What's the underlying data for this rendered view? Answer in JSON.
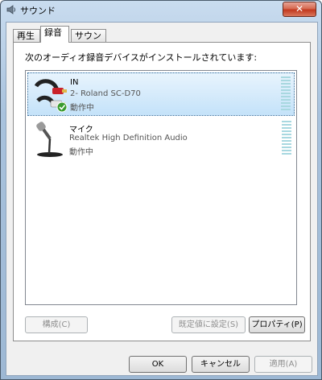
{
  "window": {
    "title": "サウンド",
    "close_label": "✕"
  },
  "tabs": [
    {
      "label": "再生"
    },
    {
      "label": "録音",
      "active": true
    },
    {
      "label": "サウンド"
    }
  ],
  "panel": {
    "instruction": "次のオーディオ録音デバイスがインストールされています:"
  },
  "devices": [
    {
      "name": "IN",
      "description": "2- Roland SC-D70",
      "status": "動作中",
      "icon": "rca-cable-icon",
      "selected": true,
      "default": true
    },
    {
      "name": "マイク",
      "description": "Realtek High Definition Audio",
      "status": "動作中",
      "icon": "microphone-icon",
      "selected": false,
      "default": false
    }
  ],
  "panel_buttons": {
    "configure": "構成(C)",
    "set_default": "既定値に設定(S)",
    "properties": "プロパティ(P)"
  },
  "dialog_buttons": {
    "ok": "OK",
    "cancel": "キャンセル",
    "apply": "適用(A)"
  },
  "colors": {
    "selection": "#c4e2f9",
    "meter": "#a8d8e0"
  }
}
